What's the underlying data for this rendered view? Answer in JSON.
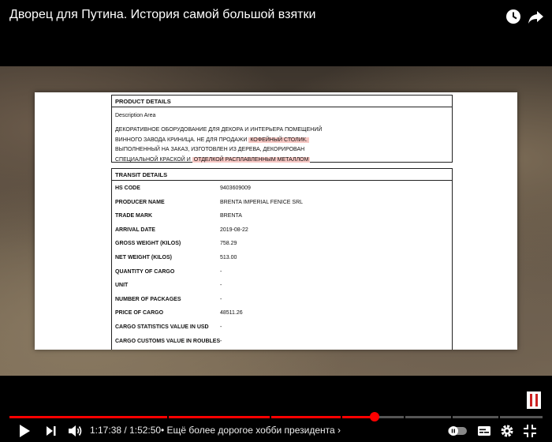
{
  "header": {
    "title": "Дворец для Путина. История самой большой взятки",
    "icons": [
      "watch-later-icon",
      "share-icon"
    ]
  },
  "document": {
    "product": {
      "heading": "PRODUCT DETAILS",
      "desc_label": "Description Area",
      "line1": "ДЕКОРАТИВНОЕ ОБОРУДОВАНИЕ ДЛЯ ДЕКОРА И ИНТЕРЬЕРА ПОМЕЩЕНИЙ",
      "line2a": "ВИННОГО ЗАВОДА КРИНИЦА. НЕ ДЛЯ ПРОДАЖИ ",
      "line2b": "КОФЕЙНЫЙ СТОЛИК.",
      "line3": "ВЫПОЛНЕННЫЙ НА ЗАКАЗ, ИЗГОТОВЛЕН ИЗ ДЕРЕВА, ДЕКОРИРОВАН",
      "line4a": "СПЕЦИАЛЬНОЙ КРАСКОЙ И ",
      "line4b": "ОТДЕЛКОЙ РАСПЛАВЛЕННЫМ МЕТАЛЛОМ",
      "highlight_color": "#f7c8c4"
    },
    "transit": {
      "heading": "TRANSIT DETAILS",
      "rows": [
        {
          "label": "HS CODE",
          "value": "9403609009"
        },
        {
          "label": "PRODUCER NAME",
          "value": "BRENTA IMPERIAL FENICE SRL"
        },
        {
          "label": "TRADE MARK",
          "value": "BRENTA"
        },
        {
          "label": "ARRIVAL DATE",
          "value": "2019-08-22"
        },
        {
          "label": "GROSS WEIGHT (KILOS)",
          "value": "758.29"
        },
        {
          "label": "NET WEIGHT (KILOS)",
          "value": "513.00"
        },
        {
          "label": "QUANTITY OF CARGO",
          "value": "-"
        },
        {
          "label": "UNIT",
          "value": "-"
        },
        {
          "label": "NUMBER OF PACKAGES",
          "value": "-"
        },
        {
          "label": "PRICE OF CARGO",
          "value": "48511.26"
        },
        {
          "label": "CARGO STATISTICS VALUE IN USD",
          "value": "-"
        },
        {
          "label": "CARGO CUSTOMS VALUE IN ROUBLES",
          "value": "-"
        }
      ]
    }
  },
  "player": {
    "current_time": "1:17:38",
    "separator": " / ",
    "duration": "1:52:50",
    "chapter_prefix": " • ",
    "chapter": "Ещё более дорогое хобби президента",
    "chapter_arrow": "›",
    "progress": 0.685,
    "accent_color": "#ff0000",
    "icons": [
      "play-icon",
      "next-icon",
      "volume-icon",
      "autoplay-toggle-icon",
      "subtitles-icon",
      "settings-icon",
      "exit-fullscreen-icon"
    ]
  }
}
